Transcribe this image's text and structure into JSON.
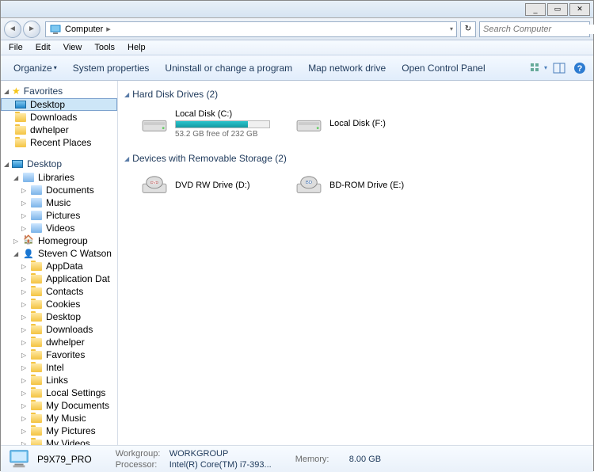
{
  "titlebar": {
    "min": "_",
    "max": "▭",
    "close": "✕"
  },
  "nav": {
    "location": "Computer",
    "search_placeholder": "Search Computer",
    "refresh": "↻"
  },
  "menu": {
    "file": "File",
    "edit": "Edit",
    "view": "View",
    "tools": "Tools",
    "help": "Help"
  },
  "toolbar": {
    "organize": "Organize",
    "sysprops": "System properties",
    "uninstall": "Uninstall or change a program",
    "mapnet": "Map network drive",
    "ctrlpanel": "Open Control Panel"
  },
  "navpane": {
    "favorites": {
      "label": "Favorites",
      "items": [
        {
          "label": "Desktop",
          "icon": "desk",
          "selected": true
        },
        {
          "label": "Downloads",
          "icon": "folder"
        },
        {
          "label": "dwhelper",
          "icon": "folder"
        },
        {
          "label": "Recent Places",
          "icon": "folder"
        }
      ]
    },
    "desktop": {
      "label": "Desktop",
      "children": {
        "libraries": {
          "label": "Libraries",
          "items": [
            {
              "label": "Documents"
            },
            {
              "label": "Music"
            },
            {
              "label": "Pictures"
            },
            {
              "label": "Videos"
            }
          ]
        },
        "homegroup": {
          "label": "Homegroup"
        },
        "user": {
          "label": "Steven C Watson",
          "items": [
            {
              "label": "AppData"
            },
            {
              "label": "Application Dat"
            },
            {
              "label": "Contacts"
            },
            {
              "label": "Cookies"
            },
            {
              "label": "Desktop"
            },
            {
              "label": "Downloads"
            },
            {
              "label": "dwhelper"
            },
            {
              "label": "Favorites"
            },
            {
              "label": "Intel"
            },
            {
              "label": "Links"
            },
            {
              "label": "Local Settings"
            },
            {
              "label": "My Documents"
            },
            {
              "label": "My Music"
            },
            {
              "label": "My Pictures"
            },
            {
              "label": "My Videos"
            }
          ]
        }
      }
    }
  },
  "content": {
    "groups": [
      {
        "header": "Hard Disk Drives (2)",
        "items": [
          {
            "name": "Local Disk (C:)",
            "free": "53.2 GB free of 232 GB",
            "fill_pct": 77,
            "type": "hdd"
          },
          {
            "name": "Local Disk (F:)",
            "type": "hdd"
          }
        ]
      },
      {
        "header": "Devices with Removable Storage (2)",
        "items": [
          {
            "name": "DVD RW Drive (D:)",
            "type": "dvd"
          },
          {
            "name": "BD-ROM Drive (E:)",
            "type": "bd"
          }
        ]
      }
    ]
  },
  "details": {
    "name": "P9X79_PRO",
    "workgroup_label": "Workgroup:",
    "workgroup": "WORKGROUP",
    "processor_label": "Processor:",
    "processor": "Intel(R) Core(TM) i7-393...",
    "memory_label": "Memory:",
    "memory": "8.00 GB"
  }
}
